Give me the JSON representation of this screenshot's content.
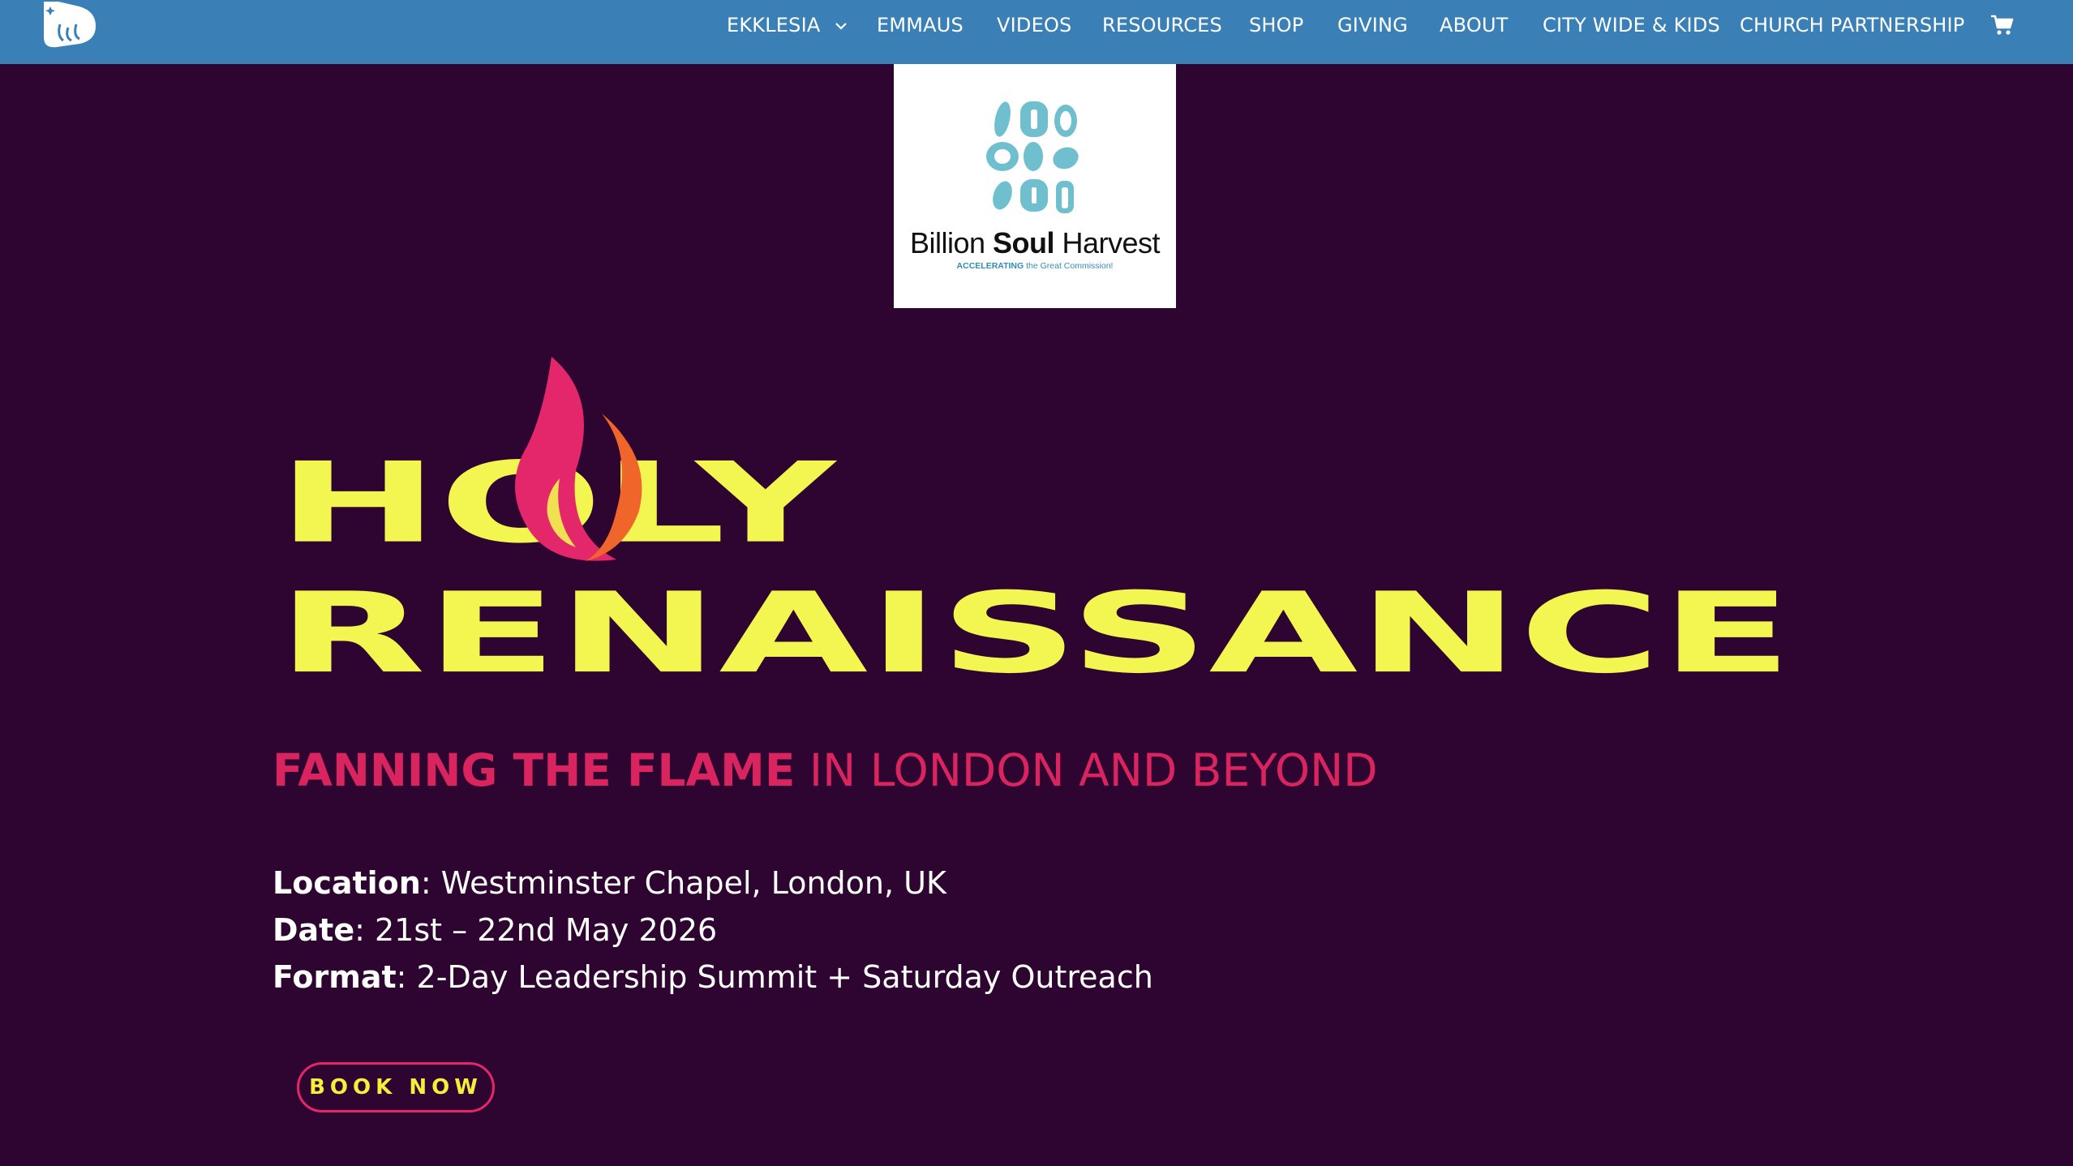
{
  "nav": {
    "logo_icon": "site-logo-icon",
    "items": [
      {
        "label": "EKKLESIA",
        "has_dropdown": true
      },
      {
        "label": "EMMAUS"
      },
      {
        "label": "VIDEOS"
      },
      {
        "label": "RESOURCES"
      },
      {
        "label": "SHOP"
      },
      {
        "label": "GIVING"
      },
      {
        "label": "ABOUT"
      },
      {
        "label": "CITY WIDE & KIDS"
      },
      {
        "label": "CHURCH PARTNERSHIP"
      }
    ],
    "cart_icon": "cart-icon",
    "background": "#3a80b6"
  },
  "partner": {
    "name_part1": "Billion ",
    "name_part2": "Soul",
    "name_part3": " Harvest",
    "tagline_part1": "ACCELERATING",
    "tagline_part2": " the Great Commission!"
  },
  "hero": {
    "title_line1": "HOLY",
    "title_line2": "RENAISSANCE",
    "title_color": "#f3f551",
    "flame_color": "#e4266a"
  },
  "subtitle": {
    "strong": "FANNING THE FLAME",
    "light": " IN LONDON AND BEYOND",
    "color": "#d9245f"
  },
  "details": [
    {
      "key": "Location",
      "value": ": Westminster Chapel, London, UK"
    },
    {
      "key": "Date",
      "value": ": 21st – 22nd May 2026"
    },
    {
      "key": "Format",
      "value": ": 2-Day Leadership Summit + Saturday Outreach"
    }
  ],
  "cta": {
    "label": "BOOK NOW"
  },
  "colors": {
    "background": "#2e0530",
    "accent_yellow": "#f3ef3a",
    "accent_pink": "#e4266a"
  }
}
